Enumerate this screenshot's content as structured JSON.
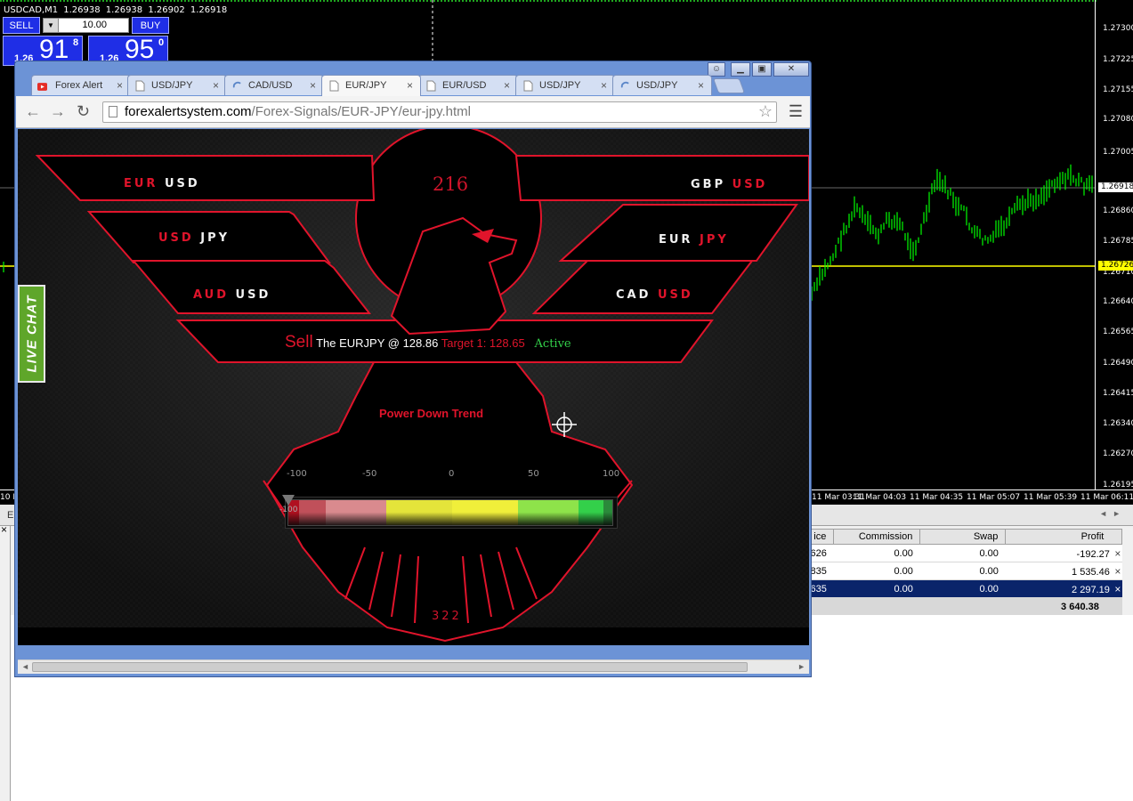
{
  "mt4": {
    "symbol": "USDCAD,M1",
    "ohlc": [
      "1.26938",
      "1.26938",
      "1.26902",
      "1.26918"
    ],
    "trade_panel": {
      "sell_label": "SELL",
      "buy_label": "BUY",
      "lot": "10.00",
      "sell_big": "1.26",
      "sell_main": "91",
      "sell_sup": "8",
      "buy_big": "1.26",
      "buy_main": "95",
      "buy_sup": "0"
    },
    "price_labels": [
      "1.27300",
      "1.27225",
      "1.27155",
      "1.27080",
      "1.27005",
      "1.26860",
      "1.26785",
      "1.26710",
      "1.26640",
      "1.26565",
      "1.26490",
      "1.26415",
      "1.26340",
      "1.26270",
      "1.26195"
    ],
    "bid_tag": "1.26918",
    "line_tag": "1.26726",
    "time_labels": [
      "10 M",
      "11 Mar 03:31",
      "11 Mar 04:03",
      "11 Mar 04:35",
      "11 Mar 05:07",
      "11 Mar 05:39",
      "11 Mar 06:11"
    ],
    "colors": {
      "candles": "#00ff00",
      "level_line": "#ffff00",
      "panel": "#1f2ee6"
    }
  },
  "terminal": {
    "headers": [
      "ice",
      "Commission",
      "Swap",
      "Profit"
    ],
    "rows": [
      {
        "price": "626",
        "commission": "0.00",
        "swap": "0.00",
        "profit": "-192.27"
      },
      {
        "price": "835",
        "commission": "0.00",
        "swap": "0.00",
        "profit": "1 535.46"
      },
      {
        "price": "635",
        "commission": "0.00",
        "swap": "0.00",
        "profit": "2 297.19"
      }
    ],
    "total": "3 640.38",
    "left_label": "E"
  },
  "browser": {
    "tabs": [
      {
        "label": "Forex Alert",
        "icon": "youtube-icon"
      },
      {
        "label": "USD/JPY",
        "icon": "page-icon"
      },
      {
        "label": "CAD/USD",
        "icon": "loading-icon"
      },
      {
        "label": "EUR/JPY",
        "icon": "page-icon",
        "active": true
      },
      {
        "label": "EUR/USD",
        "icon": "page-icon"
      },
      {
        "label": "USD/JPY",
        "icon": "page-icon"
      },
      {
        "label": "USD/JPY",
        "icon": "loading-icon"
      }
    ],
    "url_host": "forexalertsystem.com",
    "url_path": "/Forex-Signals/EUR-JPY/eur-jpy.html"
  },
  "page": {
    "pairs_left": [
      {
        "base": "EUR",
        "quote": "USD"
      },
      {
        "base": "USD",
        "quote": "JPY"
      },
      {
        "base": "AUD",
        "quote": "USD"
      }
    ],
    "pairs_right": [
      {
        "base": "GBP",
        "quote": "USD"
      },
      {
        "base": "EUR",
        "quote": "JPY"
      },
      {
        "base": "CAD",
        "quote": "USD"
      }
    ],
    "top_count": "216",
    "bottom_count": "322",
    "signal": {
      "action": "Sell",
      "text": "The EURJPY @ 128.86",
      "target": "Target 1: 128.65",
      "status": "Active"
    },
    "trend": "Power Down Trend",
    "gauge": {
      "ticks": [
        "-100",
        "-50",
        "0",
        "50",
        "100"
      ],
      "value": "-100",
      "value_num": -100
    },
    "live_chat": "LIVE CHAT",
    "colors": {
      "accent": "#e0142b",
      "status": "#33d04a",
      "live_chat": "#5fa62a"
    }
  }
}
